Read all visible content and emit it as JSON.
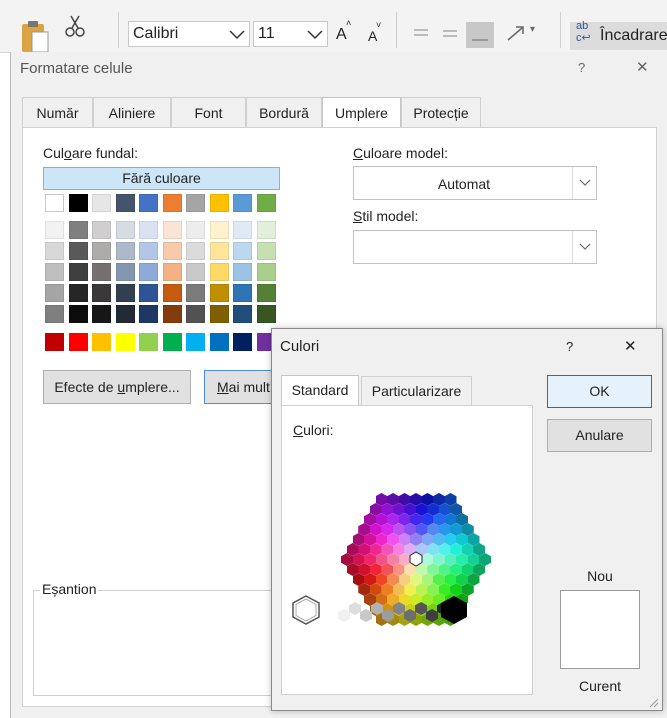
{
  "ribbon": {
    "font_name": "Calibri",
    "font_size": "11",
    "grow_font": "A",
    "shrink_font": "A",
    "wrap_text_label": "Încadrare"
  },
  "dialog": {
    "title": "Formatare celule",
    "help": "?",
    "close": "✕",
    "tabs": [
      "Număr",
      "Aliniere",
      "Font",
      "Bordură",
      "Umplere",
      "Protecție"
    ],
    "active_tab": "Umplere",
    "fill": {
      "bg_color_label_pre": "Cul",
      "bg_color_label_key": "o",
      "bg_color_label_post": "are fundal:",
      "no_color": "Fără culoare",
      "theme_colors": [
        [
          "#ffffff",
          "#000000",
          "#e7e6e6",
          "#44546a",
          "#4472c4",
          "#ed7d31",
          "#a5a5a5",
          "#ffc000",
          "#5b9bd5",
          "#70ad47"
        ],
        [
          "#f2f2f2",
          "#7f7f7f",
          "#d0cece",
          "#d6dce4",
          "#d9e2f3",
          "#fbe4d5",
          "#ededed",
          "#fff2cc",
          "#deebf6",
          "#e2efd9"
        ],
        [
          "#d8d8d8",
          "#595959",
          "#aeabab",
          "#adb9ca",
          "#b4c6e7",
          "#f7caac",
          "#dbdbdb",
          "#fee599",
          "#bdd7ee",
          "#c5e0b3"
        ],
        [
          "#bfbfbf",
          "#3f3f3f",
          "#757070",
          "#8496b0",
          "#8eaadb",
          "#f4b183",
          "#c9c9c9",
          "#ffd965",
          "#9cc3e5",
          "#a8d08d"
        ],
        [
          "#a5a5a5",
          "#262626",
          "#3a3838",
          "#323f4f",
          "#2f5496",
          "#c55a11",
          "#7b7b7b",
          "#bf8f00",
          "#2e75b5",
          "#538135"
        ],
        [
          "#7f7f7f",
          "#0c0c0c",
          "#171616",
          "#222a35",
          "#1e3864",
          "#833c0b",
          "#525252",
          "#7f6000",
          "#1e4e79",
          "#375623"
        ]
      ],
      "standard_colors": [
        "#c00000",
        "#ff0000",
        "#ffc000",
        "#ffff00",
        "#92d050",
        "#00b050",
        "#00b0f0",
        "#0070c0",
        "#002060",
        "#7030a0"
      ],
      "fill_effects_pre": "Efecte de ",
      "fill_effects_key": "u",
      "fill_effects_post": "mplere...",
      "more_colors_key": "M",
      "more_colors_post": "ai mult",
      "pattern_color_key": "C",
      "pattern_color_post": "uloare model:",
      "pattern_color_value": "Automat",
      "pattern_style_key": "S",
      "pattern_style_post": "til model:",
      "sample_label": "Eșantion"
    }
  },
  "colors_dialog": {
    "title": "Culori",
    "help": "?",
    "close": "✕",
    "tabs": [
      "Standard",
      "Particularizare"
    ],
    "active_tab": "Standard",
    "colors_label_key": "C",
    "colors_label_post": "ulori:",
    "ok": "OK",
    "cancel": "Anulare",
    "new_label": "Nou",
    "current_label": "Curent",
    "gray_hexes": [
      "#ffffff",
      "#f0f0f0",
      "#dedede",
      "#c8c8c8",
      "#b2b2b2",
      "#9c9c9c",
      "#858585",
      "#6e6e6e",
      "#565656",
      "#3e3e3e",
      "#262626",
      "#0d0d0d"
    ],
    "selected_color": "#ffffff"
  }
}
